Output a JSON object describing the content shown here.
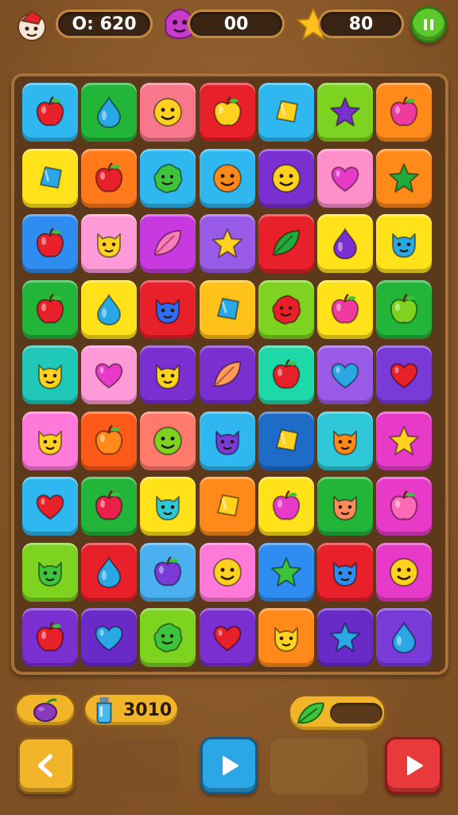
{
  "hud": {
    "score_text": "O: 620",
    "moves_text": "00",
    "stars_text": "80",
    "pause_icon": "pause-icon",
    "avatar_icon": "mascot-icon"
  },
  "board": {
    "rows": 9,
    "cols": 7,
    "tiles": [
      [
        {
          "bg": "#2fb7f0",
          "icon": "apple",
          "c": "#e8202a"
        },
        {
          "bg": "#23b43a",
          "icon": "drop",
          "c": "#2aa8e6"
        },
        {
          "bg": "#f7788a",
          "icon": "smiley",
          "c": "#ffd21f"
        },
        {
          "bg": "#e8202a",
          "icon": "apple",
          "c": "#ffd21f"
        },
        {
          "bg": "#2fb7f0",
          "icon": "gem",
          "c": "#ffd21f"
        },
        {
          "bg": "#7ed321",
          "icon": "star",
          "c": "#7a2fd0"
        },
        {
          "bg": "#ff8a1a",
          "icon": "apple",
          "c": "#ef3aa0"
        }
      ],
      [
        {
          "bg": "#ffe21a",
          "icon": "gem",
          "c": "#2aa8e6"
        },
        {
          "bg": "#ff7a1a",
          "icon": "apple",
          "c": "#e8202a"
        },
        {
          "bg": "#2fb7f0",
          "icon": "blob",
          "c": "#3cc43c"
        },
        {
          "bg": "#2fb7f0",
          "icon": "smiley",
          "c": "#ff8a1a"
        },
        {
          "bg": "#7a2fd0",
          "icon": "smiley",
          "c": "#ffd21f"
        },
        {
          "bg": "#ff8fc8",
          "icon": "heart",
          "c": "#e83ac8"
        },
        {
          "bg": "#ff8a1a",
          "icon": "star",
          "c": "#23a83a"
        }
      ],
      [
        {
          "bg": "#2f8cf0",
          "icon": "apple",
          "c": "#e8202a"
        },
        {
          "bg": "#ff9ad8",
          "icon": "cat",
          "c": "#ffd21f"
        },
        {
          "bg": "#c83ae0",
          "icon": "leaf",
          "c": "#ff7ab8"
        },
        {
          "bg": "#9a5ae8",
          "icon": "star",
          "c": "#ffd21f"
        },
        {
          "bg": "#e8202a",
          "icon": "leaf",
          "c": "#23a83a"
        },
        {
          "bg": "#ffe21a",
          "icon": "drop",
          "c": "#7a2fd0"
        },
        {
          "bg": "#ffe21a",
          "icon": "cat",
          "c": "#2aa8e6"
        }
      ],
      [
        {
          "bg": "#23b43a",
          "icon": "apple",
          "c": "#e8202a"
        },
        {
          "bg": "#ffe21a",
          "icon": "drop",
          "c": "#2aa8e6"
        },
        {
          "bg": "#e8202a",
          "icon": "cat",
          "c": "#2f6cf0"
        },
        {
          "bg": "#ffc21a",
          "icon": "gem",
          "c": "#2aa8e6"
        },
        {
          "bg": "#7ed321",
          "icon": "blob",
          "c": "#e8202a"
        },
        {
          "bg": "#ffe21a",
          "icon": "apple",
          "c": "#ef3aa0"
        },
        {
          "bg": "#23b43a",
          "icon": "apple",
          "c": "#7ed321"
        }
      ],
      [
        {
          "bg": "#1fc8b8",
          "icon": "cat",
          "c": "#ffd21f"
        },
        {
          "bg": "#ff9ad8",
          "icon": "heart",
          "c": "#e83ac8"
        },
        {
          "bg": "#7a2fd0",
          "icon": "cat",
          "c": "#ffd21f"
        },
        {
          "bg": "#7a2fd0",
          "icon": "leaf",
          "c": "#ff9a5a"
        },
        {
          "bg": "#1fd8a8",
          "icon": "apple",
          "c": "#e8202a"
        },
        {
          "bg": "#9a5ae8",
          "icon": "heart",
          "c": "#2aa8e6"
        },
        {
          "bg": "#7a3ad8",
          "icon": "heart",
          "c": "#e8202a"
        }
      ],
      [
        {
          "bg": "#ff7ad8",
          "icon": "cat",
          "c": "#ffd21f"
        },
        {
          "bg": "#ff5a1a",
          "icon": "apple",
          "c": "#ff8a1a"
        },
        {
          "bg": "#ff7a6a",
          "icon": "smiley",
          "c": "#7ed321"
        },
        {
          "bg": "#2fb7f0",
          "icon": "cat",
          "c": "#7a3ad8"
        },
        {
          "bg": "#1f6cc8",
          "icon": "gem",
          "c": "#ffd21f"
        },
        {
          "bg": "#2fc8d8",
          "icon": "cat",
          "c": "#ff8a1a"
        },
        {
          "bg": "#e83ac8",
          "icon": "star",
          "c": "#ffd21f"
        }
      ],
      [
        {
          "bg": "#2fb7f0",
          "icon": "heart",
          "c": "#e8202a"
        },
        {
          "bg": "#23b43a",
          "icon": "apple",
          "c": "#e8204a"
        },
        {
          "bg": "#ffe21a",
          "icon": "cat",
          "c": "#2fc8d8"
        },
        {
          "bg": "#ff8a1a",
          "icon": "gem",
          "c": "#ffd21f"
        },
        {
          "bg": "#ffe21a",
          "icon": "apple",
          "c": "#e83ac8"
        },
        {
          "bg": "#23b43a",
          "icon": "cat",
          "c": "#ff8a5a"
        },
        {
          "bg": "#e83ac8",
          "icon": "apple",
          "c": "#ff6ab8"
        }
      ],
      [
        {
          "bg": "#7ed321",
          "icon": "cat",
          "c": "#3cc43c"
        },
        {
          "bg": "#e8202a",
          "icon": "drop",
          "c": "#2aa8e6"
        },
        {
          "bg": "#4ab0f0",
          "icon": "apple",
          "c": "#7a3ad8"
        },
        {
          "bg": "#ff7ad8",
          "icon": "smiley",
          "c": "#ffd21f"
        },
        {
          "bg": "#2f8cf0",
          "icon": "star",
          "c": "#3cc43c"
        },
        {
          "bg": "#e8202a",
          "icon": "cat",
          "c": "#2f8cf0"
        },
        {
          "bg": "#e83ac8",
          "icon": "smiley",
          "c": "#ffd21f"
        }
      ],
      [
        {
          "bg": "#7a2fd0",
          "icon": "apple",
          "c": "#e8202a"
        },
        {
          "bg": "#6a2ac8",
          "icon": "heart",
          "c": "#2aa8e6"
        },
        {
          "bg": "#7ed321",
          "icon": "blob",
          "c": "#3cc43c"
        },
        {
          "bg": "#7a2fd0",
          "icon": "heart",
          "c": "#e8202a"
        },
        {
          "bg": "#ff8a1a",
          "icon": "cat",
          "c": "#ffd21f"
        },
        {
          "bg": "#6a2ac8",
          "icon": "star",
          "c": "#2aa8e6"
        },
        {
          "bg": "#7a3ad8",
          "icon": "drop",
          "c": "#2aa8e6"
        }
      ]
    ]
  },
  "bottom": {
    "booster_count": "3010",
    "booster_icon": "potion-icon",
    "plum_icon": "plum-icon",
    "leaf_icon": "leaf-icon",
    "progress": 0.0,
    "back_icon": "chevron-left-icon",
    "play_icon": "play-icon",
    "next_icon": "play-icon"
  },
  "colors": {
    "gold": "#f2b529",
    "brown": "#8a5a2b",
    "green_button": "#5cc82a",
    "blue_button": "#2aa8e6",
    "red_button": "#e83a3a"
  }
}
